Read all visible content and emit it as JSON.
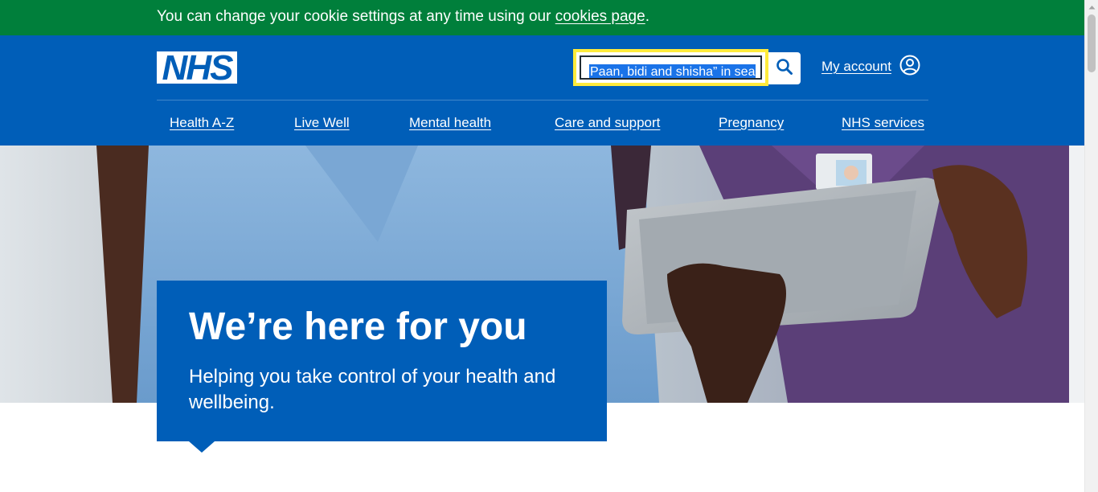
{
  "cookie_banner": {
    "text": "You can change your cookie settings at any time using our ",
    "link_label": "cookies page",
    "suffix": "."
  },
  "header": {
    "logo_text": "NHS",
    "search": {
      "value": "Paan, bidi and shisha” in sea",
      "icon": "search-icon"
    },
    "account": {
      "label": "My account",
      "icon": "user-circle-icon"
    }
  },
  "nav": {
    "items": [
      {
        "label": "Health A-Z"
      },
      {
        "label": "Live Well"
      },
      {
        "label": "Mental health"
      },
      {
        "label": "Care and support"
      },
      {
        "label": "Pregnancy"
      },
      {
        "label": "NHS services"
      }
    ]
  },
  "hero": {
    "title": "We’re here for you",
    "subtitle": "Helping you take control of your health and wellbeing."
  },
  "colors": {
    "cookie_green": "#007f3b",
    "nhs_blue": "#005eb8",
    "focus_yellow": "#ffeb3b"
  }
}
